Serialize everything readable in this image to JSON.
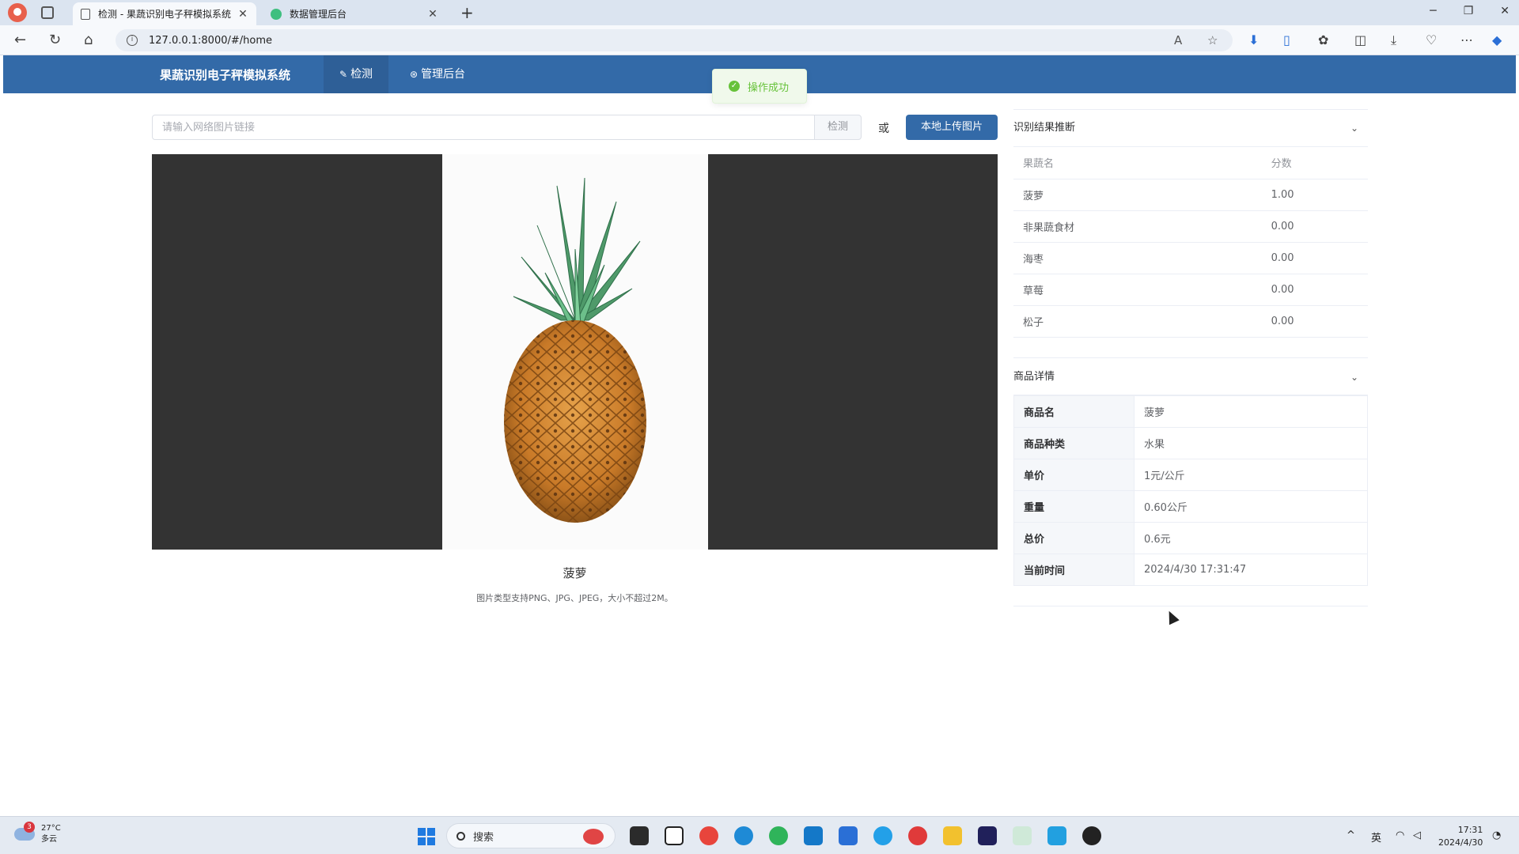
{
  "browser": {
    "tabs": [
      {
        "title": "检测 - 果蔬识别电子秤模拟系统",
        "close": "✕"
      },
      {
        "title": "数据管理后台",
        "close": "✕"
      }
    ],
    "new_tab": "+",
    "url": "127.0.0.1:8000/#/home"
  },
  "app": {
    "brand": "果蔬识别电子秤模拟系统",
    "nav": [
      {
        "label": "检测",
        "icon": "leaf-icon"
      },
      {
        "label": "管理后台",
        "icon": "settings-icon"
      }
    ]
  },
  "toast": {
    "text": "操作成功",
    "color": "#67c23a"
  },
  "search": {
    "placeholder": "请输入网络图片链接",
    "detect_label": "检测",
    "or_label": "或",
    "upload_label": "本地上传图片"
  },
  "image": {
    "caption": "菠萝",
    "hint": "图片类型支持PNG、JPG、JPEG，大小不超过2M。"
  },
  "results": {
    "section_title": "识别结果推断",
    "columns": [
      "果蔬名",
      "分数"
    ],
    "rows": [
      {
        "name": "菠萝",
        "score": "1.00"
      },
      {
        "name": "非果蔬食材",
        "score": "0.00"
      },
      {
        "name": "海枣",
        "score": "0.00"
      },
      {
        "name": "草莓",
        "score": "0.00"
      },
      {
        "name": "松子",
        "score": "0.00"
      }
    ]
  },
  "details": {
    "section_title": "商品详情",
    "rows": [
      {
        "label": "商品名",
        "value": "菠萝"
      },
      {
        "label": "商品种类",
        "value": "水果"
      },
      {
        "label": "单价",
        "value": "1元/公斤"
      },
      {
        "label": "重量",
        "value": "0.60公斤"
      },
      {
        "label": "总价",
        "value": "0.6元"
      },
      {
        "label": "当前时间",
        "value": "2024/4/30 17:31:47"
      }
    ]
  },
  "taskbar": {
    "weather_badge": "3",
    "temp": "27°C",
    "weather": "多云",
    "search_label": "搜索",
    "ime": "英",
    "time": "17:31",
    "date": "2024/4/30"
  },
  "colors": {
    "primary": "#336aa8",
    "success": "#67c23a",
    "stage_bg": "#333333"
  }
}
